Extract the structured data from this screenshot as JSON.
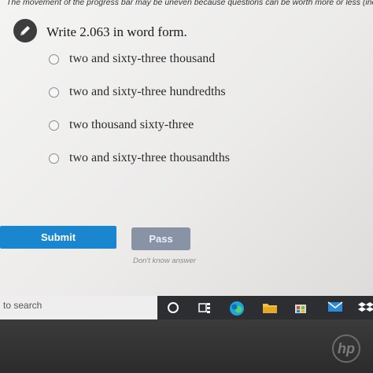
{
  "banner": {
    "notice": "The movement of the progress bar may be uneven because questions can be worth more or less (inc"
  },
  "question": {
    "icon": "pencil-icon",
    "text": "Write 2.063 in word form."
  },
  "options": [
    {
      "label": "two and sixty-three thousand",
      "selected": false
    },
    {
      "label": "two and sixty-three hundredths",
      "selected": false
    },
    {
      "label": "two thousand sixty-three",
      "selected": false
    },
    {
      "label": "two and sixty-three thousandths",
      "selected": false
    }
  ],
  "actions": {
    "submit_label": "Submit",
    "pass_label": "Pass",
    "pass_caption": "Don't know answer"
  },
  "taskbar": {
    "search_text": "to search",
    "icons": [
      "cortana-icon",
      "task-view-icon",
      "edge-icon",
      "file-explorer-icon",
      "store-icon",
      "mail-icon",
      "dropbox-icon"
    ]
  },
  "colors": {
    "accent": "#1a86d0",
    "pass": "#8893a5",
    "taskbar": "#2d2e31"
  },
  "logo": {
    "text": "hp"
  }
}
